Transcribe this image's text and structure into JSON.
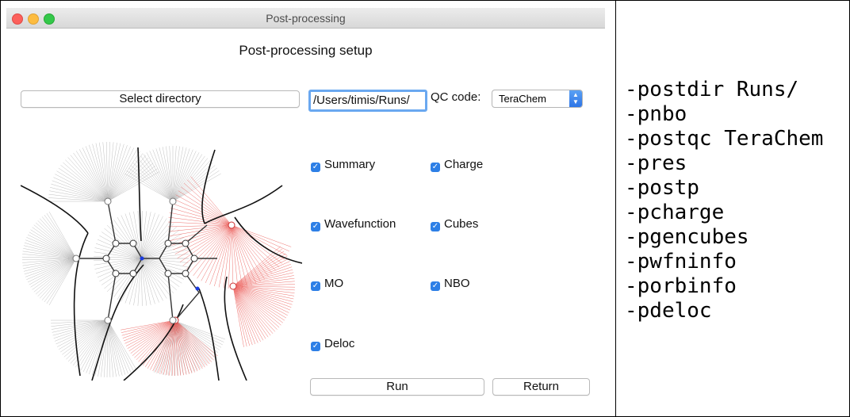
{
  "window": {
    "title": "Post-processing"
  },
  "setup": {
    "heading": "Post-processing setup",
    "select_directory_label": "Select directory",
    "directory_value": "/Users/timis/Runs/",
    "qc_label": "QC code:",
    "qc_selected": "TeraChem",
    "run_label": "Run",
    "return_label": "Return"
  },
  "options": [
    {
      "label": "Summary",
      "checked": true
    },
    {
      "label": "Charge",
      "checked": true
    },
    {
      "label": "Wavefunction",
      "checked": true
    },
    {
      "label": "Cubes",
      "checked": true
    },
    {
      "label": "MO",
      "checked": true
    },
    {
      "label": "NBO",
      "checked": true
    },
    {
      "label": "Deloc",
      "checked": true
    }
  ],
  "commands": [
    "-postdir Runs/",
    "-pnbo",
    "-postqc TeraChem",
    "-pres",
    "-postp",
    "-pcharge",
    "-pgencubes",
    "-pwfninfo",
    "-porbinfo",
    "-pdeloc"
  ],
  "colors": {
    "accent": "#2d7fe6",
    "focus": "#6aa8f0",
    "basin_red": "#e8413c"
  },
  "icons": {
    "check": "✓",
    "popup_arrows": "▲▼"
  }
}
